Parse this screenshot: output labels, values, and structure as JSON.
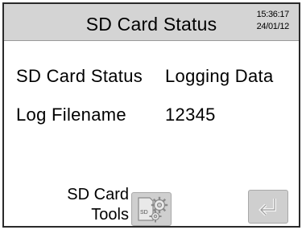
{
  "header": {
    "title": "SD Card Status",
    "time": "15:36:17",
    "date": "24/01/12"
  },
  "fields": [
    {
      "label": "SD Card Status",
      "value": "Logging Data"
    },
    {
      "label": "Log Filename",
      "value": "12345"
    }
  ],
  "buttons": {
    "tools_line1": "SD Card",
    "tools_line2": "Tools",
    "tools_icon_text": "SD",
    "tools_icon": "sd-card-gears-icon",
    "back_icon": "return-arrow-icon"
  },
  "colors": {
    "header_bg": "#d4d4d4",
    "button_bg": "#cfcfcf",
    "frame": "#2a2a2a"
  }
}
